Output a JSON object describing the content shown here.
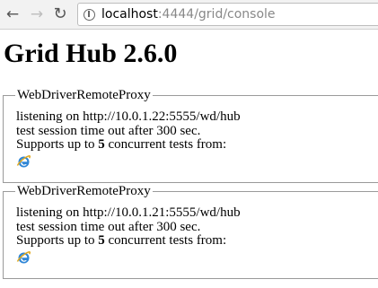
{
  "browser": {
    "url_host": "localhost",
    "url_rest": ":4444/grid/console",
    "back_icon": "back-arrow-icon",
    "forward_icon": "forward-arrow-icon",
    "reload_icon": "reload-icon",
    "page_icon": "page-info-icon"
  },
  "page": {
    "title": "Grid Hub 2.6.0"
  },
  "proxies": [
    {
      "legend": "WebDriverRemoteProxy",
      "listening": "listening on http://10.0.1.22:5555/wd/hub",
      "timeout": "test session time out after 300 sec.",
      "supports_prefix": "Supports up to ",
      "supports_count": "5",
      "supports_suffix": " concurrent tests from:",
      "browser_icon": "internet-explorer-icon"
    },
    {
      "legend": "WebDriverRemoteProxy",
      "listening": "listening on http://10.0.1.21:5555/wd/hub",
      "timeout": "test session time out after 300 sec.",
      "supports_prefix": "Supports up to ",
      "supports_count": "5",
      "supports_suffix": " concurrent tests from:",
      "browser_icon": "internet-explorer-icon"
    }
  ]
}
